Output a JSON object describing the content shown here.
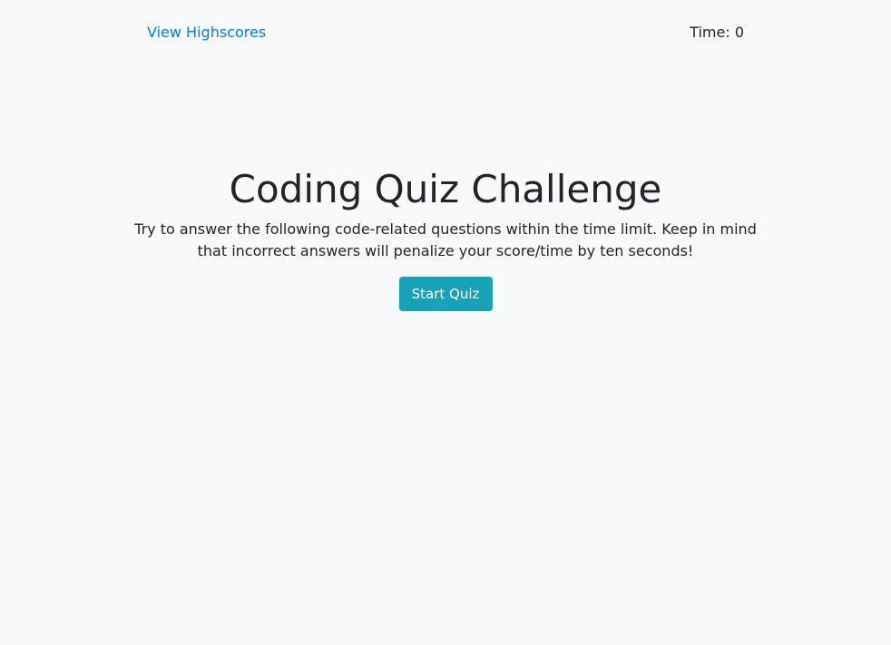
{
  "header": {
    "highscores_link": "View Highscores",
    "timer_label": "Time: ",
    "timer_value": "0"
  },
  "main": {
    "title": "Coding Quiz Challenge",
    "intro": "Try to answer the following code-related questions within the time limit. Keep in mind that incorrect answers will penalize your score/time by ten seconds!",
    "start_button": "Start Quiz"
  },
  "colors": {
    "background": "#f8f9fa",
    "link": "#007bff",
    "button": "#17a2b8",
    "text": "#212529"
  }
}
